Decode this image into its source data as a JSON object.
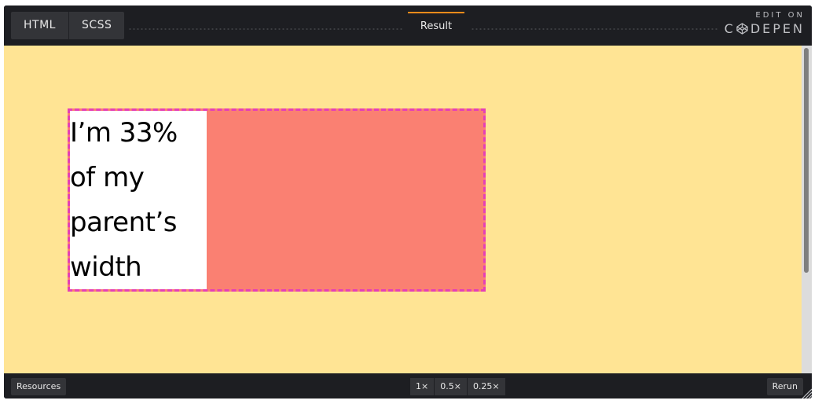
{
  "header": {
    "tabs": [
      {
        "label": "HTML"
      },
      {
        "label": "SCSS"
      }
    ],
    "result_tab": "Result",
    "brand_top": "EDIT ON",
    "brand_left": "C",
    "brand_right": "DEPEN"
  },
  "result": {
    "lines": [
      "I’m 33%",
      "of my",
      "parent’s",
      "width"
    ]
  },
  "footer": {
    "resources_label": "Resources",
    "zoom_options": [
      "1×",
      "0.5×",
      "0.25×"
    ],
    "rerun_label": "Rerun"
  },
  "colors": {
    "page_background": "#ffe494",
    "outer_box": "#fa8072",
    "outer_border": "#e53fb7",
    "inner_box": "#ffffff",
    "result_tab_accent": "#ff8c1a",
    "chrome": "#1d1e22"
  },
  "icons": {
    "logo": "codepen-cube-icon",
    "resize": "resize-grip-icon"
  }
}
